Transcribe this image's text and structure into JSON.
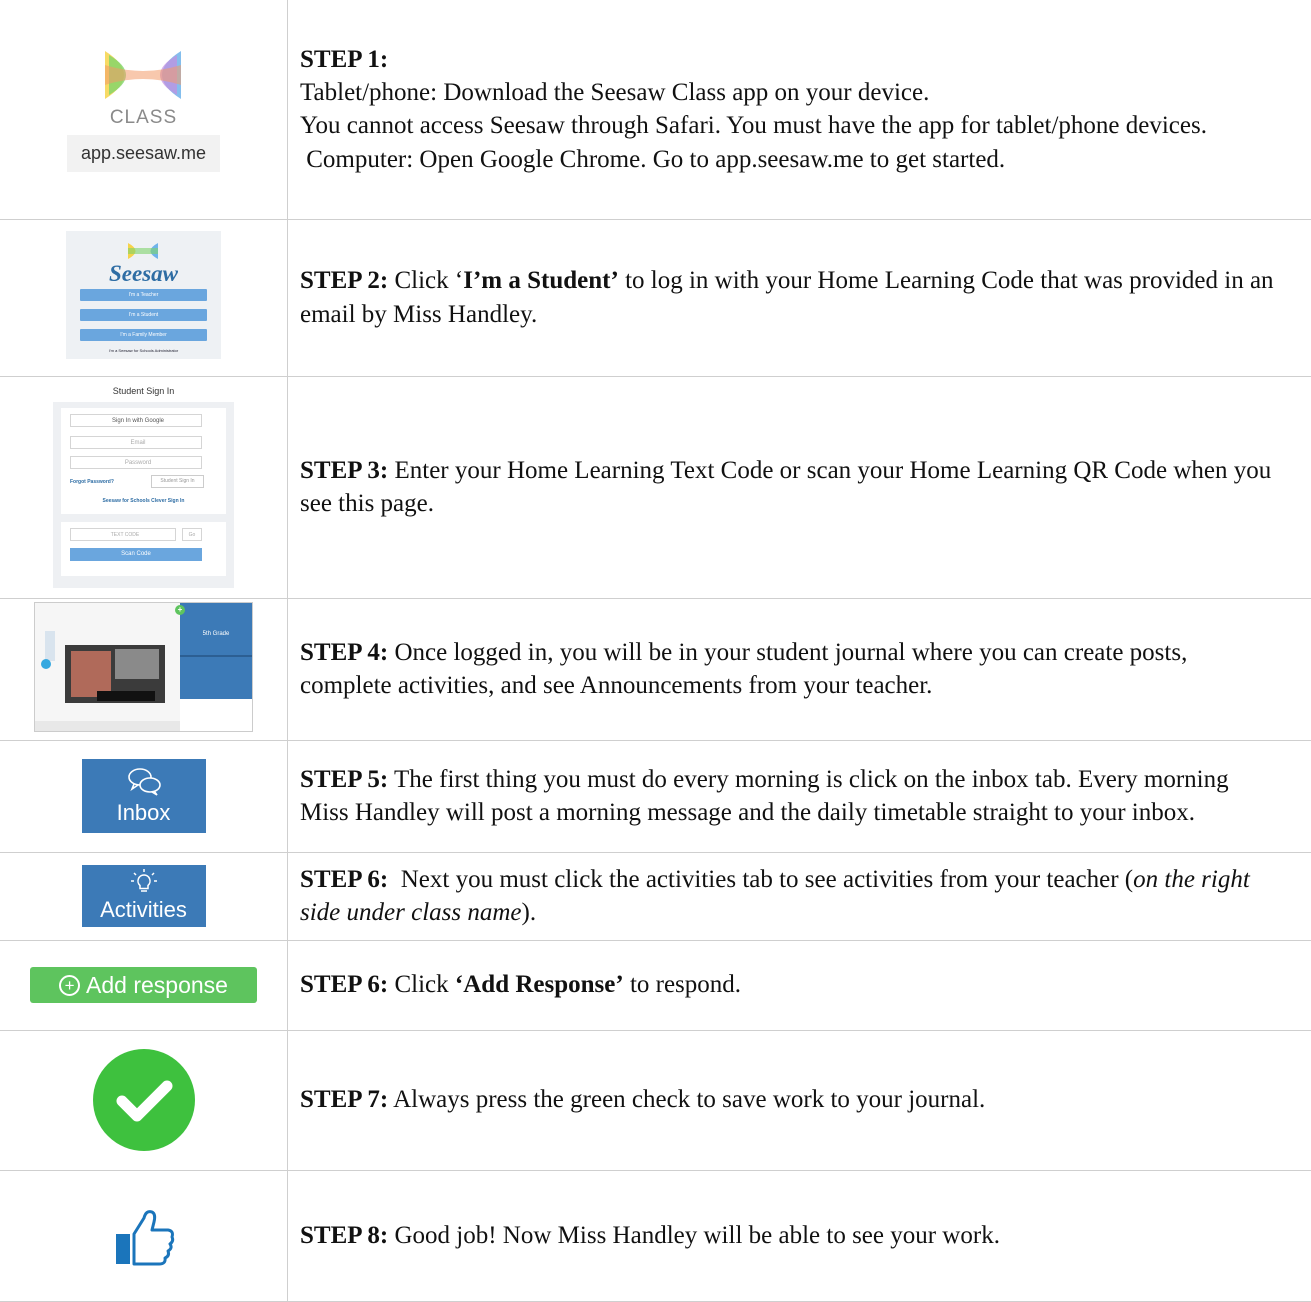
{
  "steps": [
    {
      "label": "STEP 1:",
      "lines": [
        "Tablet/phone: Download the Seesaw Class app on your device.",
        "You cannot access Seesaw through Safari. You must have the app for tablet/phone devices.",
        " Computer: Open Google Chrome. Go to app.seesaw.me to get started."
      ],
      "image": {
        "class_label": "CLASS",
        "url": "app.seesaw.me"
      }
    },
    {
      "label": "STEP 2:",
      "pre": " Click ‘",
      "bold": "I’m a Student’",
      "post": " to log in with your Home Learning Code that was provided in an email by Miss Handley.",
      "image": {
        "brand": "Seesaw",
        "buttons": [
          "I'm a Teacher",
          "I'm a Student",
          "I'm a Family Member"
        ],
        "footer": "I'm a Seesaw for Schools Administrator"
      }
    },
    {
      "label": "STEP 3:",
      "text": " Enter your Home Learning Text Code or scan your Home Learning QR Code when you see this page.",
      "image": {
        "header": "Student Sign In",
        "google": "Sign In with Google",
        "email": "Email",
        "password": "Password",
        "forgot": "Forgot Password?",
        "signin": "Student Sign In",
        "clever": "Seesaw for Schools Clever Sign In",
        "textcode": "TEXT CODE",
        "go": "Go",
        "scan": "Scan Code"
      }
    },
    {
      "label": "STEP 4:",
      "text": " Once logged in, you will be in your student journal where you can create posts, complete activities, and see Announcements from your teacher.",
      "image": {
        "class_name": "5th Grade"
      }
    },
    {
      "label": "STEP 5:",
      "text": " The first thing you must do every morning is click on the inbox tab. Every morning Miss Handley will post a morning message and the daily timetable straight to your inbox.",
      "image": {
        "tab_label": "Inbox"
      }
    },
    {
      "label": "STEP 6:",
      "text": "  Next you must click the activities tab to see activities from your teacher (",
      "italic": "on the right side under class name",
      "post": ").",
      "image": {
        "tab_label": "Activities"
      }
    },
    {
      "label": "STEP 6:",
      "pre": " Click ",
      "bold": "‘Add Response’",
      "post": " to respond.",
      "image": {
        "button_label": "Add response"
      }
    },
    {
      "label": "STEP 7:",
      "text": " Always press the green check to save work to your journal.",
      "image": {
        "icon": "green-check-icon",
        "color": "#3ec13e"
      }
    },
    {
      "label": "STEP 8:",
      "text": " Good job! Now Miss Handley will be able to see your work.",
      "image": {
        "icon": "thumbs-up-icon",
        "color": "#1b75bb"
      }
    }
  ]
}
